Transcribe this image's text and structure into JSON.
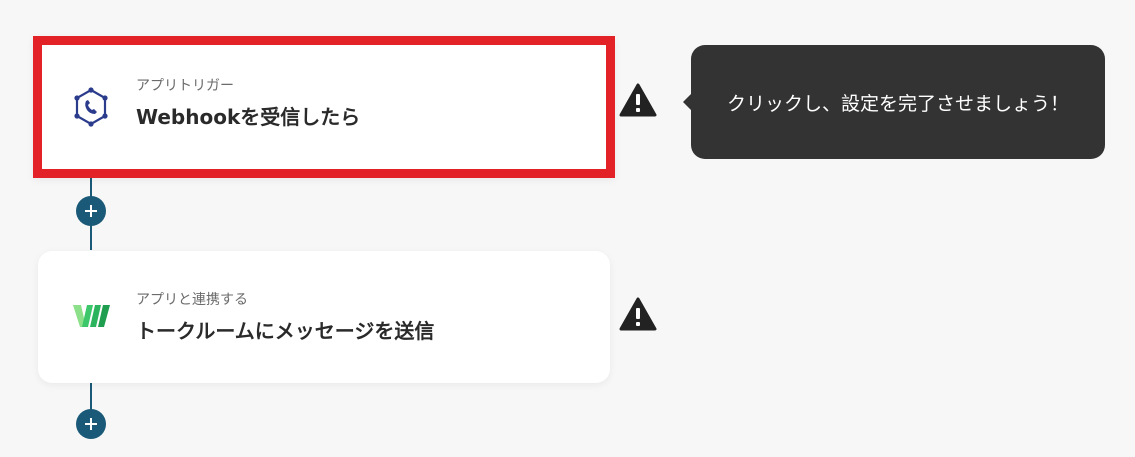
{
  "flow": {
    "steps": [
      {
        "subtitle": "アプリトリガー",
        "title": "Webhookを受信したら",
        "icon": "webhook-icon"
      },
      {
        "subtitle": "アプリと連携する",
        "title": "トークルームにメッセージを送信",
        "icon": "works-logo-icon"
      }
    ],
    "tooltip": "クリックし、設定を完了させましょう！",
    "add_symbol": "+"
  },
  "colors": {
    "accent": "#1a5a78",
    "highlight": "#e32227",
    "tooltip_bg": "#333333",
    "warning": "#222222"
  }
}
